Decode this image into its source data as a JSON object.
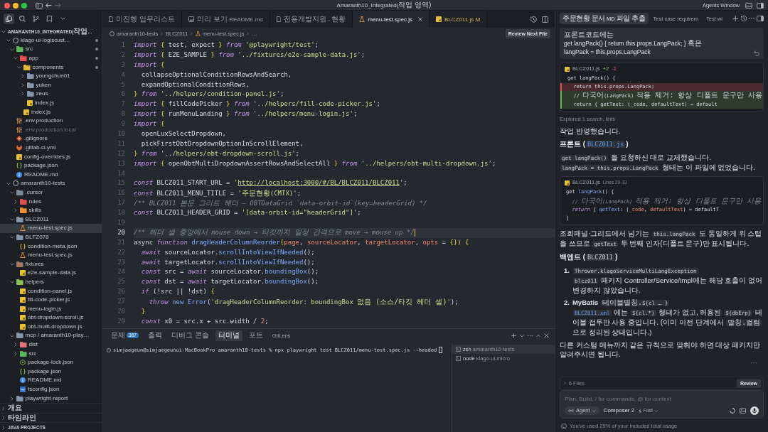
{
  "titlebar": {
    "title": "Amaranth10_Integrated(작업 영역)",
    "button": "Agents Window"
  },
  "explorer": {
    "activity": [
      {
        "kind": "files",
        "selected": true
      },
      {
        "kind": "search",
        "selected": false
      },
      {
        "kind": "branch",
        "selected": false
      },
      {
        "kind": "bookmark",
        "selected": false
      },
      {
        "kind": "more",
        "selected": false
      }
    ],
    "sections": [
      {
        "label": "AMARANTH10_INTEGRATED(작업…",
        "expanded": true,
        "children": [
          {
            "label": "klago-ui-logiscust…",
            "kind": "repo",
            "expanded": true,
            "selected": false,
            "modified": true,
            "ignored": false,
            "children": [
              {
                "label": "src",
                "kind": "folder-src",
                "expanded": true,
                "selected": false,
                "modified": true,
                "ignored": false,
                "children": [
                  {
                    "label": "app",
                    "kind": "folder-app",
                    "expanded": true,
                    "selected": false,
                    "modified": true,
                    "ignored": false,
                    "children": [
                      {
                        "label": "components",
                        "kind": "folder-components",
                        "expanded": true,
                        "selected": false,
                        "modified": true,
                        "ignored": false,
                        "children": [
                          {
                            "label": "youngchun01",
                            "kind": "folder",
                            "expanded": false,
                            "selected": false,
                            "modified": false,
                            "ignored": false
                          },
                          {
                            "label": "yuken",
                            "kind": "folder",
                            "expanded": false,
                            "selected": false,
                            "modified": false,
                            "ignored": false
                          },
                          {
                            "label": "zeus",
                            "kind": "folder",
                            "expanded": false,
                            "selected": false,
                            "modified": false,
                            "ignored": false
                          },
                          {
                            "label": "index.js",
                            "kind": "js",
                            "selected": false,
                            "modified": false,
                            "ignored": false
                          }
                        ]
                      },
                      {
                        "label": "index.js",
                        "kind": "js",
                        "selected": false,
                        "modified": false,
                        "ignored": false
                      }
                    ]
                  }
                ]
              },
              {
                "label": ".env.production",
                "kind": "env",
                "selected": false,
                "modified": false,
                "ignored": false
              },
              {
                "label": ".env.production.local",
                "kind": "env",
                "selected": false,
                "modified": false,
                "ignored": true
              },
              {
                "label": ".gitignore",
                "kind": "git",
                "selected": false,
                "modified": false,
                "ignored": false
              },
              {
                "label": ".gitlab-ci.yml",
                "kind": "gitlab",
                "selected": false,
                "modified": false,
                "ignored": false
              },
              {
                "label": "config-overrides.js",
                "kind": "js",
                "selected": false,
                "modified": false,
                "ignored": false
              },
              {
                "label": "package.json",
                "kind": "package",
                "selected": false,
                "modified": false,
                "ignored": false
              },
              {
                "label": "README.md",
                "kind": "info",
                "selected": false,
                "modified": false,
                "ignored": false
              }
            ]
          },
          {
            "label": "amaranth10-tests",
            "kind": "repo",
            "expanded": true,
            "selected": false,
            "modified": false,
            "ignored": false,
            "children": [
              {
                "label": ".cursor",
                "kind": "folder-config",
                "expanded": true,
                "selected": false,
                "modified": false,
                "ignored": false,
                "children": [
                  {
                    "label": "rules",
                    "kind": "folder-rules",
                    "expanded": false,
                    "selected": false,
                    "modified": false,
                    "ignored": false
                  },
                  {
                    "label": "skills",
                    "kind": "folder-skills",
                    "expanded": false,
                    "selected": false,
                    "modified": false,
                    "ignored": false
                  }
                ]
              },
              {
                "label": "BLCZ011",
                "kind": "folder",
                "expanded": true,
                "selected": false,
                "modified": false,
                "ignored": false,
                "children": [
                  {
                    "label": "menu-test.spec.js",
                    "kind": "test",
                    "selected": true,
                    "modified": false,
                    "ignored": false
                  }
                ]
              },
              {
                "label": "BLFZ078",
                "kind": "folder",
                "expanded": true,
                "selected": false,
                "modified": false,
                "ignored": false,
                "children": [
                  {
                    "label": "condition-meta.json",
                    "kind": "json",
                    "selected": false,
                    "modified": false,
                    "ignored": false
                  },
                  {
                    "label": "menu-test.spec.js",
                    "kind": "test",
                    "selected": false,
                    "modified": false,
                    "ignored": false
                  }
                ]
              },
              {
                "label": "fixtures",
                "kind": "folder-fixtures",
                "expanded": true,
                "selected": false,
                "modified": false,
                "ignored": false,
                "children": [
                  {
                    "label": "e2e-sample-data.js",
                    "kind": "js",
                    "selected": false,
                    "modified": false,
                    "ignored": false
                  }
                ]
              },
              {
                "label": "helpers",
                "kind": "folder-helpers",
                "expanded": true,
                "selected": false,
                "modified": false,
                "ignored": false,
                "children": [
                  {
                    "label": "condition-panel.js",
                    "kind": "js",
                    "selected": false,
                    "modified": false,
                    "ignored": false
                  },
                  {
                    "label": "fill-code-picker.js",
                    "kind": "js",
                    "selected": false,
                    "modified": false,
                    "ignored": false
                  },
                  {
                    "label": "menu-login.js",
                    "kind": "js",
                    "selected": false,
                    "modified": false,
                    "ignored": false
                  },
                  {
                    "label": "obt-dropdown-scroll.js",
                    "kind": "js",
                    "selected": false,
                    "modified": false,
                    "ignored": false
                  },
                  {
                    "label": "obt-multi-dropdown.js",
                    "kind": "js",
                    "selected": false,
                    "modified": false,
                    "ignored": false
                  }
                ]
              },
              {
                "label": "mcp / amaranth10-play…",
                "kind": "folder",
                "expanded": true,
                "selected": false,
                "modified": false,
                "ignored": false,
                "children": [
                  {
                    "label": "dist",
                    "kind": "folder-dist",
                    "expanded": false,
                    "selected": false,
                    "modified": false,
                    "ignored": false
                  },
                  {
                    "label": "src",
                    "kind": "folder-src",
                    "expanded": false,
                    "selected": false,
                    "modified": false,
                    "ignored": false
                  },
                  {
                    "label": "package-lock.json",
                    "kind": "lock",
                    "selected": false,
                    "modified": false,
                    "ignored": false
                  },
                  {
                    "label": "package.json",
                    "kind": "package",
                    "selected": false,
                    "modified": false,
                    "ignored": false
                  },
                  {
                    "label": "README.md",
                    "kind": "info",
                    "selected": false,
                    "modified": false,
                    "ignored": false
                  },
                  {
                    "label": "tsconfig.json",
                    "kind": "ts",
                    "selected": false,
                    "modified": false,
                    "ignored": false
                  }
                ]
              },
              {
                "label": "playwright-report",
                "kind": "folder",
                "expanded": false,
                "selected": false,
                "modified": false,
                "ignored": false
              }
            ]
          }
        ]
      },
      {
        "label": "개요",
        "expanded": false
      },
      {
        "label": "타임라인",
        "expanded": false
      },
      {
        "label": "JAVA PROJECTS",
        "expanded": false
      }
    ]
  },
  "editor": {
    "tabs": [
      {
        "kind": "doc",
        "label": "미진행 업무리스트",
        "selected": false,
        "modified": false
      },
      {
        "kind": "preview",
        "label": "미리 보기 README.md",
        "selected": false,
        "modified": false
      },
      {
        "kind": "doc",
        "label": "전용개발지원 - 현황",
        "selected": false,
        "modified": false
      },
      {
        "kind": "test",
        "label": "menu-test.spec.js",
        "selected": true,
        "modified": false
      },
      {
        "kind": "js",
        "label": "BLCZ011.js",
        "badge": "M",
        "selected": false,
        "modified": true
      }
    ],
    "breadcrumb": [
      {
        "kind": "repo",
        "label": "amaranth10-tests"
      },
      {
        "kind": "folder",
        "label": "BLCZ011"
      },
      {
        "kind": "test",
        "label": "menu-test.spec.js"
      },
      {
        "kind": "symbol",
        "label": "…"
      }
    ],
    "review_button": "Review Next File",
    "code": [
      {
        "number": "1",
        "current": false,
        "tokens": [
          {
            "kind": "kw",
            "text": "import "
          },
          {
            "kind": "br",
            "text": "{"
          },
          {
            "kind": "id",
            "text": " test, expect "
          },
          {
            "kind": "br",
            "text": "}"
          },
          {
            "kind": "kw",
            "text": " from "
          },
          {
            "kind": "str",
            "text": "'@playwright/test'"
          },
          {
            "kind": "id",
            "text": ";"
          }
        ]
      },
      {
        "number": "2",
        "current": false,
        "tokens": [
          {
            "kind": "kw",
            "text": "import "
          },
          {
            "kind": "br",
            "text": "{"
          },
          {
            "kind": "id",
            "text": " E2E_SAMPLE "
          },
          {
            "kind": "br",
            "text": "}"
          },
          {
            "kind": "kw",
            "text": " from "
          },
          {
            "kind": "str",
            "text": "'../fixtures/e2e-sample-data.js'"
          },
          {
            "kind": "id",
            "text": ";"
          }
        ]
      },
      {
        "number": "3",
        "current": false,
        "tokens": [
          {
            "kind": "kw",
            "text": "import "
          },
          {
            "kind": "br",
            "text": "{"
          }
        ]
      },
      {
        "number": "4",
        "current": false,
        "tokens": [
          {
            "kind": "id",
            "text": "  collapseOptionalConditionRowsAndSearch,"
          }
        ]
      },
      {
        "number": "5",
        "current": false,
        "tokens": [
          {
            "kind": "id",
            "text": "  expandOptionalConditionRows,"
          }
        ]
      },
      {
        "number": "6",
        "current": false,
        "tokens": [
          {
            "kind": "br",
            "text": "}"
          },
          {
            "kind": "kw",
            "text": " from "
          },
          {
            "kind": "str",
            "text": "'../helpers/condition-panel.js'"
          },
          {
            "kind": "id",
            "text": ";"
          }
        ]
      },
      {
        "number": "7",
        "current": false,
        "tokens": [
          {
            "kind": "kw",
            "text": "import "
          },
          {
            "kind": "br",
            "text": "{"
          },
          {
            "kind": "id",
            "text": " fillCodePicker "
          },
          {
            "kind": "br",
            "text": "}"
          },
          {
            "kind": "kw",
            "text": " from "
          },
          {
            "kind": "str",
            "text": "'../helpers/fill-code-picker.js'"
          },
          {
            "kind": "id",
            "text": ";"
          }
        ]
      },
      {
        "number": "8",
        "current": false,
        "tokens": [
          {
            "kind": "kw",
            "text": "import "
          },
          {
            "kind": "br",
            "text": "{"
          },
          {
            "kind": "id",
            "text": " runMenuLanding "
          },
          {
            "kind": "br",
            "text": "}"
          },
          {
            "kind": "kw",
            "text": " from "
          },
          {
            "kind": "str",
            "text": "'../helpers/menu-login.js'"
          },
          {
            "kind": "id",
            "text": ";"
          }
        ]
      },
      {
        "number": "9",
        "current": false,
        "tokens": [
          {
            "kind": "kw",
            "text": "import "
          },
          {
            "kind": "br",
            "text": "{"
          }
        ]
      },
      {
        "number": "10",
        "current": false,
        "tokens": [
          {
            "kind": "id",
            "text": "  openLuxSelectDropdown,"
          }
        ]
      },
      {
        "number": "11",
        "current": false,
        "tokens": [
          {
            "kind": "id",
            "text": "  pickFirstObtDropdownOptionInScrollElement,"
          }
        ]
      },
      {
        "number": "12",
        "current": false,
        "tokens": [
          {
            "kind": "br",
            "text": "}"
          },
          {
            "kind": "kw",
            "text": " from "
          },
          {
            "kind": "str",
            "text": "'../helpers/obt-dropdown-scroll.js'"
          },
          {
            "kind": "id",
            "text": ";"
          }
        ]
      },
      {
        "number": "13",
        "current": false,
        "tokens": [
          {
            "kind": "kw",
            "text": "import "
          },
          {
            "kind": "br",
            "text": "{"
          },
          {
            "kind": "id",
            "text": " openObtMultiDropdownAssertRowsAndSelectAll "
          },
          {
            "kind": "br",
            "text": "}"
          },
          {
            "kind": "kw",
            "text": " from "
          },
          {
            "kind": "str",
            "text": "'../helpers/obt-multi-dropdown.js'"
          },
          {
            "kind": "id",
            "text": ";"
          }
        ]
      },
      {
        "number": "14",
        "current": false
      },
      {
        "number": "15",
        "current": false,
        "tokens": [
          {
            "kind": "kw",
            "text": "const "
          },
          {
            "kind": "id",
            "text": "BLCZ011_START_URL = "
          },
          {
            "kind": "str",
            "text": "'"
          },
          {
            "kind": "url",
            "text": "http://localhost:3000/#/BL/BLCZ011/BLCZ011"
          },
          {
            "kind": "str",
            "text": "'"
          },
          {
            "kind": "id",
            "text": ";"
          }
        ]
      },
      {
        "number": "16",
        "current": false,
        "tokens": [
          {
            "kind": "kw",
            "text": "const "
          },
          {
            "kind": "id",
            "text": "BLCZ011_MENU_TITLE = "
          },
          {
            "kind": "str",
            "text": "'주문현황(CMTX)'"
          },
          {
            "kind": "id",
            "text": ";"
          }
        ]
      },
      {
        "number": "17",
        "current": false,
        "tokens": [
          {
            "kind": "com",
            "text": "/** BLCZ011 본문 그리드 헤더 — OBTDataGrid `data-orbit-id`(key=headerGrid) */"
          }
        ]
      },
      {
        "number": "18",
        "current": false,
        "tokens": [
          {
            "kind": "kw",
            "text": "const "
          },
          {
            "kind": "id",
            "text": "BLCZ011_HEADER_GRID = "
          },
          {
            "kind": "str",
            "text": "'[data-orbit-id=\"headerGrid\"]'"
          },
          {
            "kind": "id",
            "text": ";"
          }
        ]
      },
      {
        "number": "19",
        "current": false
      },
      {
        "number": "20",
        "current": true,
        "tokens": [
          {
            "kind": "com",
            "text": "/** 헤더 셀 중앙에서 mouse down → 타깃까지 일정 간격으로 move → mouse up */"
          }
        ]
      },
      {
        "number": "21",
        "current": false,
        "tokens": [
          {
            "kind": "id",
            "text": "async "
          },
          {
            "kind": "kw",
            "text": "function "
          },
          {
            "kind": "fn",
            "text": "dragHeaderColumnReorder"
          },
          {
            "kind": "br",
            "text": "("
          },
          {
            "kind": "par",
            "text": "page"
          },
          {
            "kind": "id",
            "text": ", "
          },
          {
            "kind": "par",
            "text": "sourceLocator"
          },
          {
            "kind": "id",
            "text": ", "
          },
          {
            "kind": "par",
            "text": "targetLocator"
          },
          {
            "kind": "id",
            "text": ", "
          },
          {
            "kind": "par",
            "text": "opts"
          },
          {
            "kind": "id",
            "text": " = "
          },
          {
            "kind": "br",
            "text": "{}) {"
          }
        ]
      },
      {
        "number": "22",
        "current": false,
        "tokens": [
          {
            "kind": "kw",
            "text": "  await "
          },
          {
            "kind": "id",
            "text": "sourceLocator."
          },
          {
            "kind": "fn",
            "text": "scrollIntoViewIfNeeded"
          },
          {
            "kind": "id",
            "text": "();"
          }
        ]
      },
      {
        "number": "23",
        "current": false,
        "tokens": [
          {
            "kind": "kw",
            "text": "  await "
          },
          {
            "kind": "id",
            "text": "targetLocator."
          },
          {
            "kind": "fn",
            "text": "scrollIntoViewIfNeeded"
          },
          {
            "kind": "id",
            "text": "();"
          }
        ]
      },
      {
        "number": "24",
        "current": false,
        "tokens": [
          {
            "kind": "kw",
            "text": "  const "
          },
          {
            "kind": "id",
            "text": "src = "
          },
          {
            "kind": "kw",
            "text": "await "
          },
          {
            "kind": "id",
            "text": "sourceLocator."
          },
          {
            "kind": "fn",
            "text": "boundingBox"
          },
          {
            "kind": "id",
            "text": "();"
          }
        ]
      },
      {
        "number": "25",
        "current": false,
        "tokens": [
          {
            "kind": "kw",
            "text": "  const "
          },
          {
            "kind": "id",
            "text": "dst = "
          },
          {
            "kind": "kw",
            "text": "await "
          },
          {
            "kind": "id",
            "text": "targetLocator."
          },
          {
            "kind": "fn",
            "text": "boundingBox"
          },
          {
            "kind": "id",
            "text": "();"
          }
        ]
      },
      {
        "number": "26",
        "current": false,
        "tokens": [
          {
            "kind": "kw",
            "text": "  if "
          },
          {
            "kind": "id",
            "text": "(!src || !dst) "
          },
          {
            "kind": "br",
            "text": "{"
          }
        ]
      },
      {
        "number": "27",
        "current": false,
        "tokens": [
          {
            "kind": "kw",
            "text": "    throw "
          },
          {
            "kind": "fn",
            "text": "new Error"
          },
          {
            "kind": "id",
            "text": "("
          },
          {
            "kind": "str",
            "text": "'dragHeaderColumnReorder: boundingBox 없음 (소스/타깃 헤더 셀)'"
          },
          {
            "kind": "id",
            "text": ");"
          }
        ]
      },
      {
        "number": "28",
        "current": false,
        "tokens": [
          {
            "kind": "br",
            "text": "  }"
          }
        ]
      },
      {
        "number": "29",
        "current": false,
        "tokens": [
          {
            "kind": "kw",
            "text": "  const "
          },
          {
            "kind": "id",
            "text": "x0 = src.x + src.width / "
          },
          {
            "kind": "num",
            "text": "2"
          },
          {
            "kind": "id",
            "text": ";"
          }
        ]
      }
    ]
  },
  "panel": {
    "tabs": [
      {
        "label": "문제",
        "badge": "367",
        "selected": false
      },
      {
        "label": "출력",
        "selected": false
      },
      {
        "label": "디버그 콘솔",
        "selected": false
      },
      {
        "label": "터미널",
        "selected": true
      },
      {
        "label": "포트",
        "selected": false
      },
      {
        "label": "GitLens",
        "selected": false
      }
    ],
    "terminal": {
      "command": "simjaegeun@simjaegeunui-MacBookPro amaranth10-tests % npx playwright test BLCZ011/menu-test.spec.js --headed",
      "sessions": [
        {
          "name": "zsh",
          "detail": "amaranth10-tests",
          "selected": true
        },
        {
          "name": "node",
          "detail": "klago-ui-micro",
          "selected": false
        }
      ]
    }
  },
  "chat": {
    "tabs": [
      {
        "label": "주문현황 문서 MD 파일 추출",
        "selected": true
      },
      {
        "label": "Test case requirem",
        "selected": false
      },
      {
        "label": "Test wi",
        "selected": false
      }
    ],
    "user_message": [
      "프론트코드에는",
      "get langPack() { return this.props.LangPack; } 혹은",
      "langPack = this.props.LangPack"
    ],
    "diff": {
      "file": "BLCZ011.js",
      "added": "+2",
      "removed": "-1",
      "lines": [
        {
          "kind": "context",
          "text": "get langPack() {"
        },
        {
          "kind": "removed",
          "text": "  return this.props.LangPack;"
        },
        {
          "kind": "added",
          "text": "  // 다국어(LangPack) 적용 제거: 항상 디폴트 문구만 사용"
        },
        {
          "kind": "added",
          "text": "  return { getText: (_code, defaultText) ⇒ default"
        }
      ]
    },
    "explored": "Explored 1 search, lints",
    "blocks": [
      {
        "kind": "paragraph",
        "segments": [
          {
            "kind": "text",
            "text": "작업 반영했습니다."
          }
        ]
      },
      {
        "kind": "heading",
        "segments": [
          {
            "kind": "text",
            "text": "프론트 ("
          },
          {
            "kind": "link",
            "text": "BLCZ011.js"
          },
          {
            "kind": "text",
            "text": ")"
          }
        ]
      },
      {
        "kind": "paragraph",
        "segments": [
          {
            "kind": "code",
            "text": "get langPack()"
          },
          {
            "kind": "text",
            "text": " 을 요청하신 대로 교체했습니다. "
          },
          {
            "kind": "code",
            "text": "langPack = this.props.LangPack"
          },
          {
            "kind": "text",
            "text": " 형태는 이 파일에 없었습니다."
          }
        ]
      },
      {
        "kind": "code_block",
        "file": "BLCZ011.js",
        "range": "Lines 29-33",
        "lines": [
          {
            "tokens": [
              {
                "kind": "id",
                "text": "get "
              },
              {
                "kind": "fn",
                "text": "langPack"
              },
              {
                "kind": "id",
                "text": "() {"
              }
            ]
          },
          {
            "tokens": [
              {
                "kind": "com",
                "text": "  // 다국어(LangPack) 적용 제거: 항상 디폴트 문구만 사용"
              }
            ]
          },
          {
            "tokens": [
              {
                "kind": "kw",
                "text": "  return "
              },
              {
                "kind": "id",
                "text": "{ "
              },
              {
                "kind": "fn",
                "text": "getText"
              },
              {
                "kind": "id",
                "text": ": ("
              },
              {
                "kind": "par",
                "text": "_code"
              },
              {
                "kind": "id",
                "text": ", "
              },
              {
                "kind": "par",
                "text": "defaultText"
              },
              {
                "kind": "id",
                "text": ") ⇒ defaultT"
              }
            ]
          },
          {
            "tokens": [
              {
                "kind": "id",
                "text": "}"
              }
            ]
          }
        ]
      },
      {
        "kind": "paragraph",
        "segments": [
          {
            "kind": "text",
            "text": "조회패널·그리드에서 넘기는 "
          },
          {
            "kind": "code",
            "text": "this.langPack"
          },
          {
            "kind": "text",
            "text": " 도 동일하게 위 스텁을 쓰므로 "
          },
          {
            "kind": "code",
            "text": "getText"
          },
          {
            "kind": "text",
            "text": " 두 번째 인자(디폴트 문구)만 표시됩니다."
          }
        ]
      },
      {
        "kind": "heading",
        "segments": [
          {
            "kind": "text",
            "text": "백엔드 ("
          },
          {
            "kind": "code",
            "text": "BLCZ011"
          },
          {
            "kind": "text",
            "text": ")"
          }
        ]
      },
      {
        "kind": "list",
        "items": [
          {
            "number": "1.",
            "lines": [
              [
                {
                  "kind": "code",
                  "text": "Thrower.klagoServiceMultiLangException"
                }
              ],
              [
                {
                  "kind": "code",
                  "text": "blcz011"
                },
                {
                  "kind": "text",
                  "text": " 패키지 Controller/Service/Impl에는 해당 호출이 없어 변경하지 않았습니다."
                }
              ]
            ]
          },
          {
            "number": "2.",
            "lines": [
              [
                {
                  "kind": "bold",
                  "text": "MyBatis "
                },
                {
                  "kind": "code",
                  "text": "테이블별칭.${cl … }"
                }
              ],
              [
                {
                  "kind": "link",
                  "text": "BLCZ011.xml"
                },
                {
                  "kind": "text",
                  "text": " 에는 "
                },
                {
                  "kind": "code",
                  "text": "${cl.*}"
                },
                {
                  "kind": "text",
                  "text": " 형태가 없고, 허용된 "
                },
                {
                  "kind": "code",
                  "text": "${dbErp}"
                },
                {
                  "kind": "text",
                  "text": " 테이블 접두만 사용 중입니다. (이미 이전 단계에서 "
                },
                {
                  "kind": "code",
                  "text": "별칭.컬럼"
                },
                {
                  "kind": "text",
                  "text": " 으로 정리된 상태입니다.)"
                }
              ]
            ]
          }
        ]
      },
      {
        "kind": "paragraph",
        "segments": [
          {
            "kind": "text",
            "text": "다른 커스텀 메뉴까지 같은 규칙으로 맞춰야 하면 대상 패키지만 알려주시면 됩니다."
          }
        ]
      }
    ],
    "changes": {
      "label": "6 Files",
      "button": "Review"
    },
    "composer": {
      "placeholder": "Plan, Build, / for commands, @ for context",
      "mode": "Agent",
      "model": "Composer 2",
      "speed": "Fast"
    },
    "usage": "You've used 29% of your included total usage"
  }
}
